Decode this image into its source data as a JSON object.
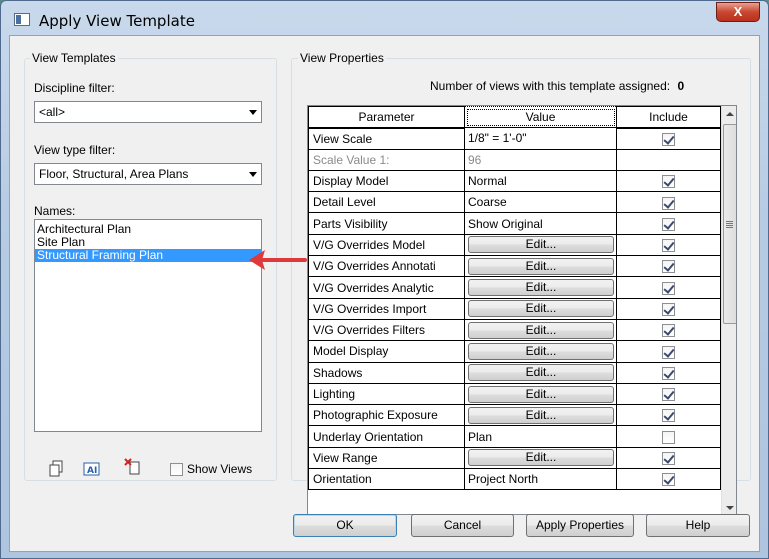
{
  "window": {
    "title": "Apply View Template",
    "close_label": "X"
  },
  "view_templates": {
    "group_label": "View Templates",
    "discipline_filter_label": "Discipline filter:",
    "discipline_filter_value": "<all>",
    "view_type_filter_label": "View type filter:",
    "view_type_filter_value": "Floor, Structural, Area Plans",
    "names_label": "Names:",
    "names": [
      "Architectural Plan",
      "Site Plan",
      "Structural Framing Plan"
    ],
    "selected_index": 2,
    "show_views_label": "Show Views",
    "show_views_checked": false,
    "icons": [
      "duplicate-icon",
      "rename-icon",
      "delete-icon"
    ]
  },
  "view_properties": {
    "group_label": "View Properties",
    "count_label": "Number of views with this template assigned:",
    "count_value": "0",
    "columns": [
      "Parameter",
      "Value",
      "Include"
    ],
    "rows": [
      {
        "parameter": "View Scale",
        "value": "1/8\" = 1'-0\"",
        "type": "text",
        "include": true
      },
      {
        "parameter": "Scale Value   1:",
        "value": "96",
        "type": "text",
        "include": null,
        "disabled": true
      },
      {
        "parameter": "Display Model",
        "value": "Normal",
        "type": "text",
        "include": true
      },
      {
        "parameter": "Detail Level",
        "value": "Coarse",
        "type": "text",
        "include": true
      },
      {
        "parameter": "Parts Visibility",
        "value": "Show Original",
        "type": "text",
        "include": true
      },
      {
        "parameter": "V/G Overrides Model",
        "value": "Edit...",
        "type": "button",
        "include": true
      },
      {
        "parameter": "V/G Overrides Annotati",
        "value": "Edit...",
        "type": "button",
        "include": true
      },
      {
        "parameter": "V/G Overrides Analytic",
        "value": "Edit...",
        "type": "button",
        "include": true
      },
      {
        "parameter": "V/G Overrides Import",
        "value": "Edit...",
        "type": "button",
        "include": true
      },
      {
        "parameter": "V/G Overrides Filters",
        "value": "Edit...",
        "type": "button",
        "include": true
      },
      {
        "parameter": "Model Display",
        "value": "Edit...",
        "type": "button",
        "include": true
      },
      {
        "parameter": "Shadows",
        "value": "Edit...",
        "type": "button",
        "include": true
      },
      {
        "parameter": "Lighting",
        "value": "Edit...",
        "type": "button",
        "include": true
      },
      {
        "parameter": "Photographic Exposure",
        "value": "Edit...",
        "type": "button",
        "include": true
      },
      {
        "parameter": "Underlay Orientation",
        "value": "Plan",
        "type": "text",
        "include": false
      },
      {
        "parameter": "View Range",
        "value": "Edit...",
        "type": "button",
        "include": true
      },
      {
        "parameter": "Orientation",
        "value": "Project North",
        "type": "text",
        "include": true
      }
    ]
  },
  "buttons": {
    "ok": "OK",
    "cancel": "Cancel",
    "apply_properties": "Apply Properties",
    "help": "Help"
  },
  "colors": {
    "selection": "#3399ff",
    "annotation_arrow": "#e0393b"
  }
}
